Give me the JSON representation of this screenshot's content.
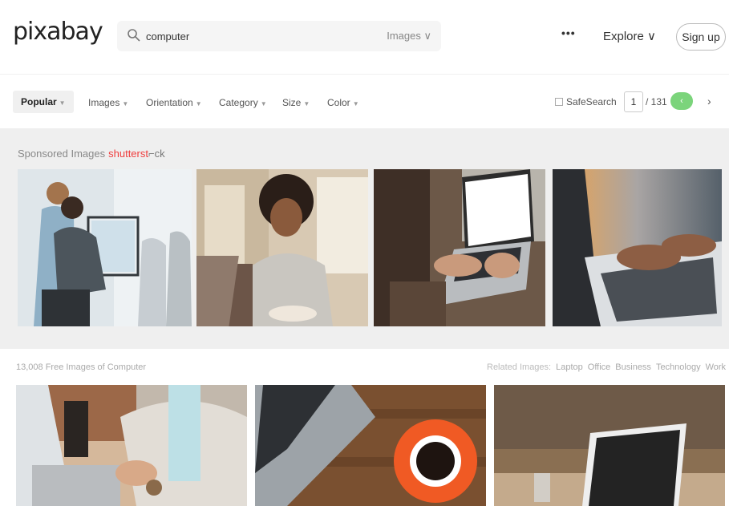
{
  "header": {
    "logo": "pixabay",
    "search_value": "computer",
    "search_type": "Images ∨",
    "more": "•••",
    "explore": "Explore ∨",
    "signup": "Sign up"
  },
  "filters": {
    "popular": "Popular",
    "images": "Images",
    "orientation": "Orientation",
    "category": "Category",
    "size": "Size",
    "color": "Color",
    "safesearch": "SafeSearch",
    "page": "1",
    "total": "/ 131",
    "next": "‹",
    "arrow": "›"
  },
  "sponsored": {
    "label": "Sponsored Images",
    "brand_a": "shutterst",
    "brand_b": "⌐ck"
  },
  "results": {
    "count": "13,008 Free Images of Computer",
    "related_label": "Related Images:",
    "related": [
      "Laptop",
      "Office",
      "Business",
      "Technology",
      "Work"
    ]
  },
  "icons": [
    "search-icon",
    "caret-down-icon",
    "checkbox-icon",
    "chevron-right-icon"
  ],
  "colors": {
    "accent": "#7bd47b",
    "brand_red": "#ef3d3d",
    "section_bg": "#efefef"
  }
}
